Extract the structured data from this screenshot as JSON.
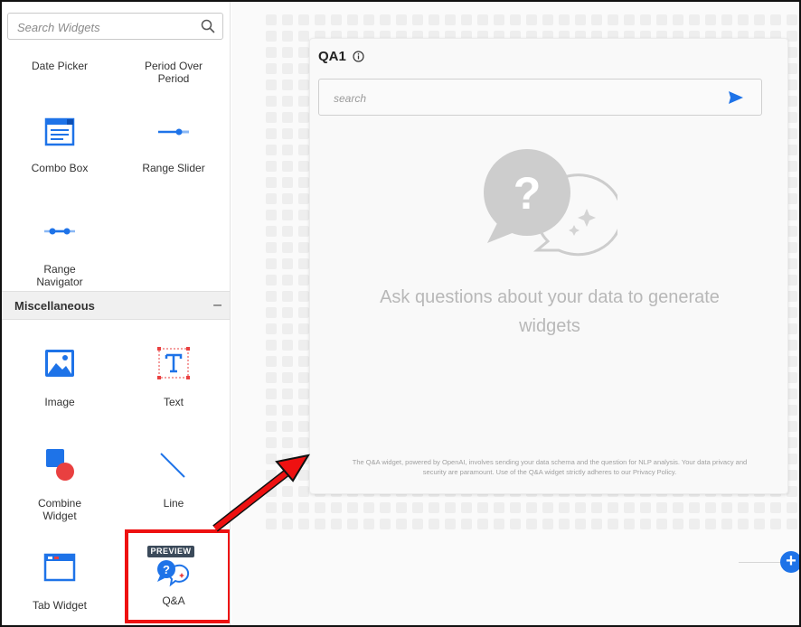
{
  "sidebar": {
    "search_placeholder": "Search Widgets",
    "widgets_top": [
      {
        "label": "Date Picker"
      },
      {
        "label": "Period Over Period"
      },
      {
        "label": "Combo Box"
      },
      {
        "label": "Range Slider"
      },
      {
        "label": "Range Navigator"
      }
    ],
    "section": {
      "title": "Miscellaneous",
      "collapse_symbol": "–"
    },
    "widgets_misc": [
      {
        "label": "Image"
      },
      {
        "label": "Text"
      },
      {
        "label": "Combine Widget"
      },
      {
        "label": "Line"
      },
      {
        "label": "Tab Widget"
      },
      {
        "label": "Q&A",
        "badge": "PREVIEW"
      }
    ]
  },
  "canvas": {
    "qa_widget": {
      "title": "QA1",
      "search_placeholder": "search",
      "message": "Ask questions about your data to generate widgets",
      "disclaimer": "The Q&A widget, powered by OpenAI, involves sending your data schema and the question for NLP analysis. Your data privacy and security are paramount. Use of the Q&A widget strictly adheres to our Privacy Policy."
    },
    "add_button_symbol": "+"
  },
  "colors": {
    "accent": "#1e73e8",
    "highlight": "#e11111",
    "badge_bg": "#3b4a5a",
    "icon_red": "#e94040"
  }
}
